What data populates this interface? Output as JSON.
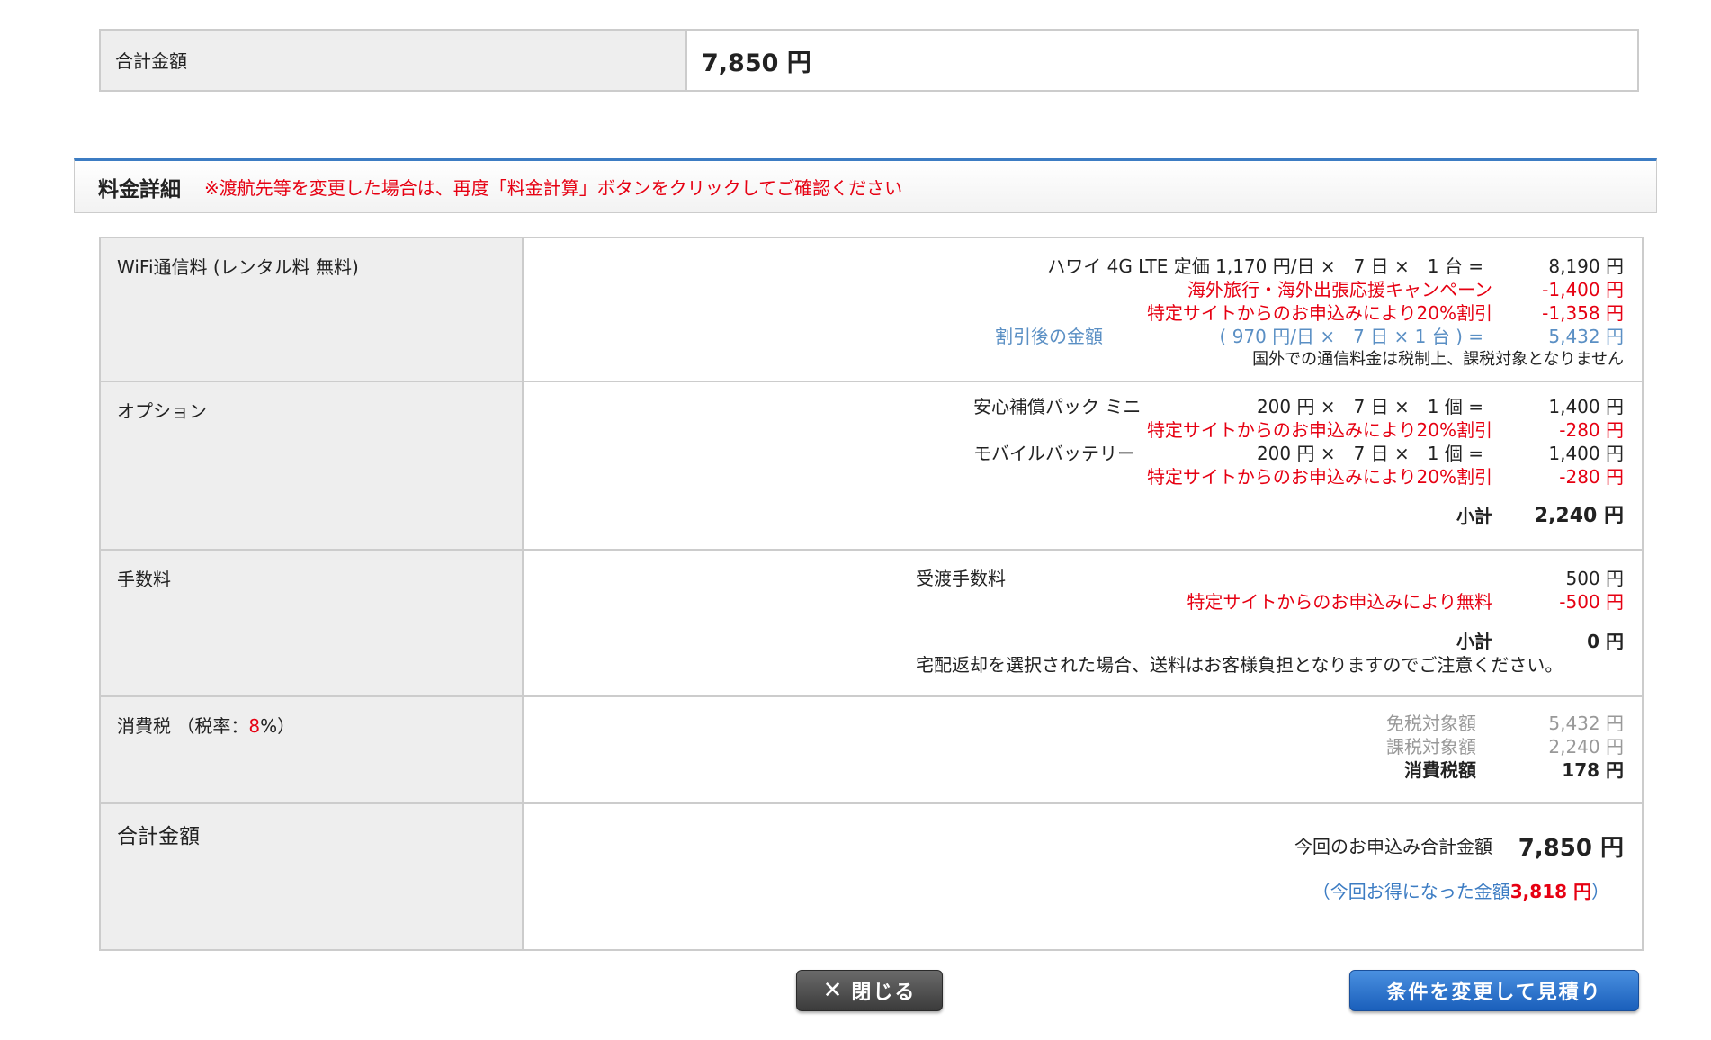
{
  "summary": {
    "label": "合計金額",
    "value": "7,850 円"
  },
  "section": {
    "title": "料金詳細",
    "note": "※渡航先等を変更した場合は、再度「料金計算」ボタンをクリックしてご確認ください"
  },
  "wifi": {
    "label": "WiFi通信料 (レンタル料 無料)",
    "line1_desc": "ハワイ 4G LTE 定価 1,170 円/日 ×　7 日 ×　1 台 =",
    "line1_amt": "8,190 円",
    "line2_desc": "海外旅行・海外出張応援キャンペーン",
    "line2_amt": "-1,400 円",
    "line3_desc": "特定サイトからのお申込みにより20%割引",
    "line3_amt": "-1,358 円",
    "line4_label": "割引後の金額",
    "line4_desc": "( 970 円/日 ×　7 日 × 1 台 ) =",
    "line4_amt": "5,432 円",
    "note": "国外での通信料金は税制上、課税対象となりません"
  },
  "option": {
    "label": "オプション",
    "item1_name": "安心補償パック ミニ",
    "item1_calc": "200 円 ×　7 日 ×　1 個 =",
    "item1_amt": "1,400 円",
    "item1_disc": "特定サイトからのお申込みにより20%割引",
    "item1_disc_amt": "-280 円",
    "item2_name": "モバイルバッテリー",
    "item2_calc": "200 円 ×　7 日 ×　1 個 =",
    "item2_amt": "1,400 円",
    "item2_disc": "特定サイトからのお申込みにより20%割引",
    "item2_disc_amt": "-280 円",
    "subtotal_label": "小計",
    "subtotal_amt": "2,240 円"
  },
  "fee": {
    "label": "手数料",
    "item_name": "受渡手数料",
    "item_amt": "500 円",
    "disc": "特定サイトからのお申込みにより無料",
    "disc_amt": "-500 円",
    "subtotal_label": "小計",
    "subtotal_amt": "0 円",
    "note": "宅配返却を選択された場合、送料はお客様負担となりますのでご注意ください。"
  },
  "tax": {
    "label_pre": "消費税 （税率：",
    "rate": "8",
    "label_post": "%）",
    "exempt_label": "免税対象額",
    "exempt_amt": "5,432 円",
    "taxable_label": "課税対象額",
    "taxable_amt": "2,240 円",
    "tax_label": "消費税額",
    "tax_amt": "178 円"
  },
  "total": {
    "label": "合計金額",
    "desc": "今回のお申込み合計金額",
    "amt": "7,850 円",
    "saved_pre": "（今回お得になった金額",
    "saved_amt": "3,818 円",
    "saved_post": "）"
  },
  "buttons": {
    "close": "閉じる",
    "close_icon": "✕",
    "estimate": "条件を変更して見積り"
  }
}
